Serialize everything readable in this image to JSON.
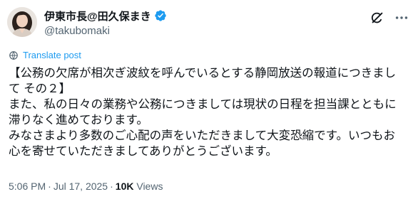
{
  "author": {
    "display_name": "伊東市長@田久保まき",
    "handle": "@takubomaki"
  },
  "icons": {
    "verified": "verified-badge-icon",
    "grok": "grok-icon",
    "more": "more-options-icon",
    "translate": "globe-icon"
  },
  "colors": {
    "accent": "#1d9bf0",
    "text_primary": "#0f1419",
    "text_secondary": "#536471"
  },
  "translate": {
    "label": "Translate post"
  },
  "tweet": {
    "lines": [
      "【公務の欠席が相次ぎ波紋を呼んでいるとする静岡放送の報道につきまし",
      "て その２】",
      "また、私の日々の業務や公務につきましては現状の日程を担当課とともに",
      "滞りなく進めております。",
      "みなさまより多数のご心配の声をいただきまして大変恐縮です。いつもお",
      "心を寄せていただきましてありがとうございます。"
    ]
  },
  "meta": {
    "time": "5:06 PM",
    "date": "Jul 17, 2025",
    "separator": "·",
    "views_count": "10K",
    "views_label": "Views"
  }
}
